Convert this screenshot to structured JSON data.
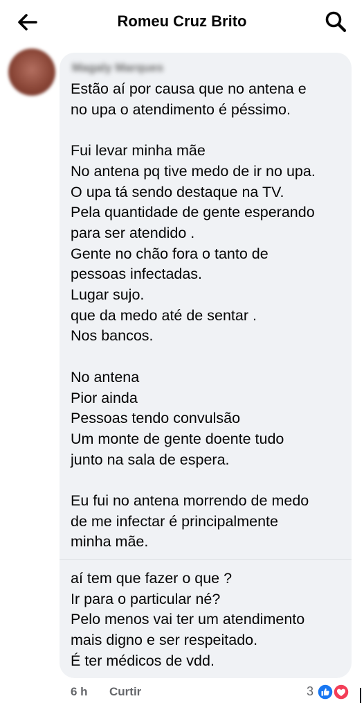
{
  "header": {
    "title": "Romeu Cruz Brito",
    "back_icon": "arrow-left-icon",
    "search_icon": "search-icon"
  },
  "comment": {
    "author": "Magaly Marques",
    "text_part1": "Estão aí por causa que no antena e\nno upa o atendimento é péssimo.\n\nFui levar minha mãe\nNo antena pq tive medo de ir no upa.\nO upa tá sendo destaque na TV.\nPela quantidade de gente esperando\npara ser atendido .\nGente no chão fora o tanto de\npessoas infectadas.\nLugar sujo.\nque da medo até de sentar .\nNos bancos.\n\nNo antena\nPior ainda\nPessoas tendo convulsão\nUm monte de gente doente tudo\njunto na sala de espera.\n\nEu fui no antena morrendo de medo\nde me infectar é principalmente\nminha mãe.",
    "text_part2": "aí tem que fazer o que ?\nIr para o particular né?\nPelo menos vai ter um atendimento\nmais digno e ser respeitado.\nÉ ter médicos de vdd."
  },
  "footer": {
    "time": "6 h",
    "like_label": "Curtir",
    "reaction_count": "3",
    "reactions": [
      "like-reaction-icon",
      "love-reaction-icon"
    ]
  },
  "colors": {
    "bubble_bg": "#f0f2f5",
    "text": "#050505",
    "secondary_text": "#65676b",
    "like_blue": "#1877f2",
    "love_red": "#f33e58"
  }
}
